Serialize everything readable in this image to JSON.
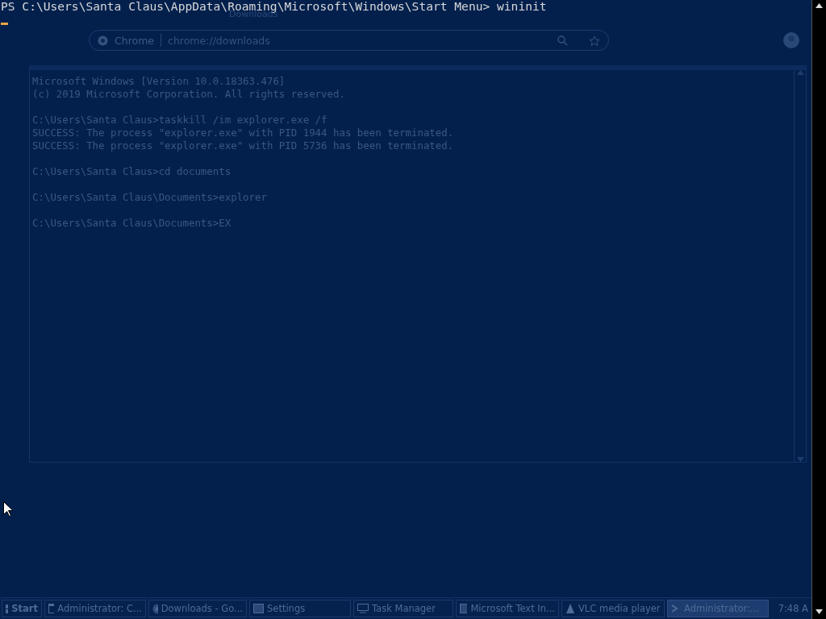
{
  "powershell": {
    "prompt_line": "PS C:\\Users\\Santa Claus\\AppData\\Roaming\\Microsoft\\Windows\\Start Menu> wininit"
  },
  "browser": {
    "tab_title": "Downloads",
    "omnibox": {
      "site": "Chrome",
      "url": "chrome://downloads"
    }
  },
  "console": {
    "blocks": [
      [
        "Microsoft Windows [Version 10.0.18363.476]",
        "(c) 2019 Microsoft Corporation. All rights reserved."
      ],
      [
        "C:\\Users\\Santa Claus>taskkill /im explorer.exe /f",
        "SUCCESS: The process \"explorer.exe\" with PID 1944 has been terminated.",
        "SUCCESS: The process \"explorer.exe\" with PID 5736 has been terminated."
      ],
      [
        "C:\\Users\\Santa Claus>cd documents"
      ],
      [
        "C:\\Users\\Santa Claus\\Documents>explorer"
      ],
      [
        "C:\\Users\\Santa Claus\\Documents>EX"
      ]
    ]
  },
  "taskbar": {
    "start": "Start",
    "items": [
      {
        "label": "Administrator: C...",
        "kind": "console",
        "selected": false
      },
      {
        "label": "Downloads - Go...",
        "kind": "browser",
        "selected": false
      },
      {
        "label": "Settings",
        "kind": "window",
        "selected": false
      },
      {
        "label": "Task Manager",
        "kind": "monitor",
        "selected": false
      },
      {
        "label": "Microsoft Text In...",
        "kind": "window",
        "selected": false
      },
      {
        "label": "VLC media player",
        "kind": "cone",
        "selected": false
      },
      {
        "label": "Administrator:...",
        "kind": "shell",
        "selected": true
      }
    ],
    "clock": "7:48 A"
  }
}
